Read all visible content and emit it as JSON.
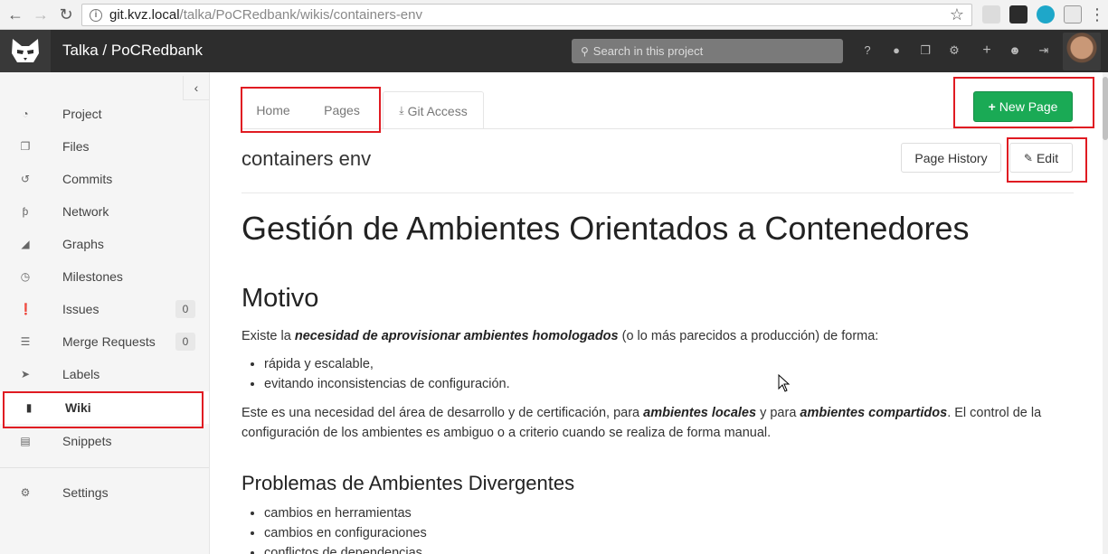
{
  "browser": {
    "url_host": "git.kvz.local",
    "url_path": "/talka/PoCRedbank/wikis/containers-env"
  },
  "header": {
    "title": "Talka / PoCRedbank",
    "search_placeholder": "Search in this project"
  },
  "sidebar": {
    "items": [
      {
        "label": "Project",
        "icon": "dashboard-icon"
      },
      {
        "label": "Files",
        "icon": "files-icon"
      },
      {
        "label": "Commits",
        "icon": "history-icon"
      },
      {
        "label": "Network",
        "icon": "code-fork-icon"
      },
      {
        "label": "Graphs",
        "icon": "area-chart-icon"
      },
      {
        "label": "Milestones",
        "icon": "clock-icon"
      },
      {
        "label": "Issues",
        "icon": "exclamation-circle-icon",
        "count": "0"
      },
      {
        "label": "Merge Requests",
        "icon": "tasks-icon",
        "count": "0"
      },
      {
        "label": "Labels",
        "icon": "tags-icon"
      },
      {
        "label": "Wiki",
        "icon": "book-icon"
      },
      {
        "label": "Snippets",
        "icon": "file-text-icon"
      },
      {
        "label": "Settings",
        "icon": "cogs-icon"
      }
    ]
  },
  "tabs": {
    "home": "Home",
    "pages": "Pages",
    "git_access": "Git Access"
  },
  "actions": {
    "new_page": "New Page",
    "page_history": "Page History",
    "edit": "Edit"
  },
  "page": {
    "title": "containers env",
    "h1": "Gestión de Ambientes Orientados a Contenedores",
    "h2_motivo": "Motivo",
    "p1_a": "Existe la ",
    "p1_b": "necesidad de aprovisionar ambientes homologados",
    "p1_c": " (o lo más parecidos a producción) de forma:",
    "list1": [
      "rápida y escalable,",
      "evitando inconsistencias de configuración."
    ],
    "p2_a": "Este es una necesidad del área de desarrollo y de certificación, para ",
    "p2_b": "ambientes locales",
    "p2_c": " y para ",
    "p2_d": "ambientes compartidos",
    "p2_e": ". El control de la configuración de los ambientes es ambiguo o a criterio cuando se realiza de forma manual.",
    "h3": "Problemas de Ambientes Divergentes",
    "list2": [
      "cambios en herramientas",
      "cambios en configuraciones",
      "conflictos de dependencias"
    ]
  },
  "colors": {
    "header_bg": "#2d2d2d",
    "new_page_green": "#1aaa55",
    "highlight_red": "#e01b22"
  }
}
